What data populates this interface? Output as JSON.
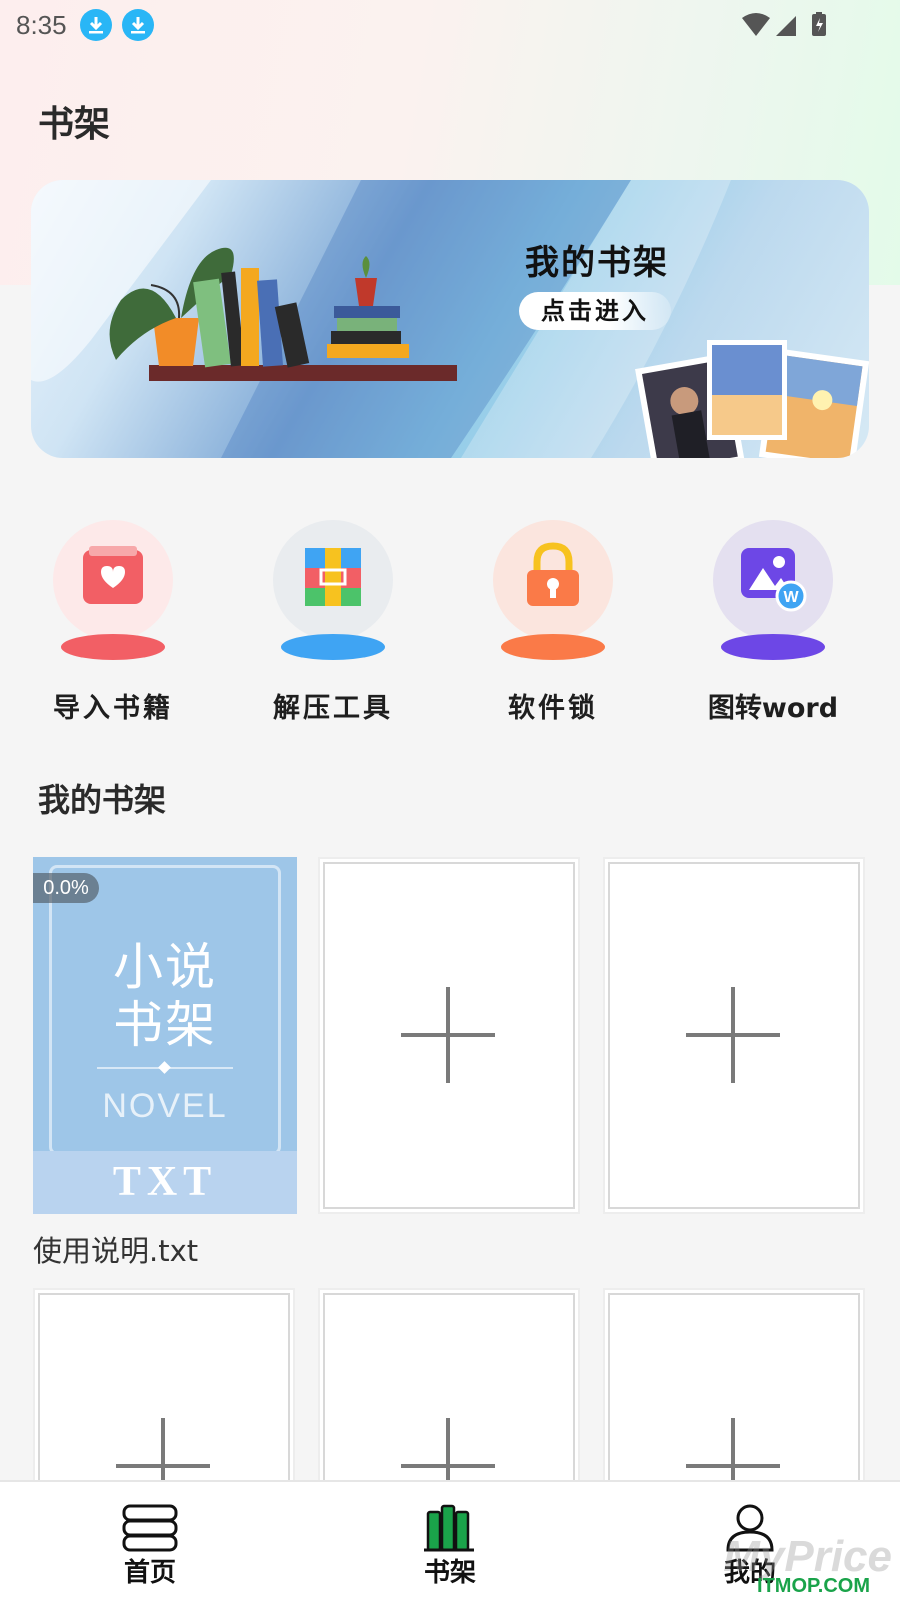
{
  "status_bar": {
    "time": "8:35"
  },
  "page_title": "书架",
  "banner": {
    "title": "我的书架",
    "button_label": "点击进入"
  },
  "tools": [
    {
      "label": "导入书籍",
      "icon": "import-book-icon",
      "color": "#f25f65",
      "bg": "#fde9e9"
    },
    {
      "label": "解压工具",
      "icon": "unzip-tool-icon",
      "color": "#3fa4f3",
      "bg": "#e9ecef"
    },
    {
      "label": "软件锁",
      "icon": "app-lock-icon",
      "color": "#fa7a48",
      "bg": "#fbe5de"
    },
    {
      "label": "图转word",
      "icon": "image-to-word-icon",
      "color": "#6d47e6",
      "bg": "#e4e0f0"
    }
  ],
  "shelf_section_title": "我的书架",
  "books": [
    {
      "name": "使用说明.txt",
      "progress": "0.0%",
      "cover_title_line1": "小说",
      "cover_title_line2": "书架",
      "cover_subtitle": "NOVEL",
      "cover_format": "TXT"
    }
  ],
  "bottom_nav": [
    {
      "label": "首页",
      "icon": "home-books-icon",
      "active": false
    },
    {
      "label": "书架",
      "icon": "bookshelf-icon",
      "active": true
    },
    {
      "label": "我的",
      "icon": "profile-icon",
      "active": false
    }
  ],
  "watermark": {
    "text": "MyPrice",
    "site": "ITMOP.COM"
  },
  "colors": {
    "accent_green": "#1aa34a",
    "download_icon": "#29b6f6"
  }
}
